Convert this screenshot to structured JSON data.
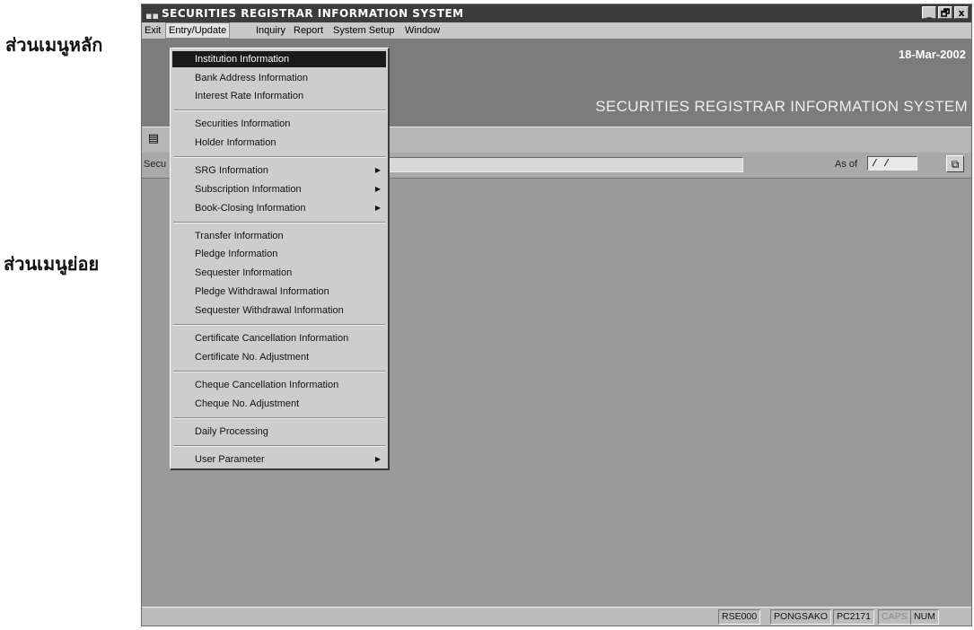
{
  "annotations": {
    "main_menu": "ส่วนเมนูหลัก",
    "sub_menu": "ส่วนเมนูย่อย"
  },
  "window": {
    "title": "SECURITIES REGISTRAR INFORMATION SYSTEM",
    "icon": "app-icon",
    "controls": [
      "_",
      "🗗",
      "x"
    ]
  },
  "menubar": {
    "items": [
      "Exit",
      "Entry/Update",
      "Inquiry",
      "Report",
      "System Setup",
      "Window"
    ]
  },
  "banner": {
    "date": "18-Mar-2002",
    "system_title": "SECURITIES REGISTRAR INFORMATION SYSTEM"
  },
  "filter": {
    "security_label": "Secu",
    "as_of_label": "As of",
    "date_value": "/ /"
  },
  "dropdown": {
    "items": [
      {
        "label": "Institution Information",
        "selected": true
      },
      {
        "label": "Bank Address Information"
      },
      {
        "label": "Interest Rate Information"
      },
      {
        "label": "Securities Information"
      },
      {
        "label": "Holder Information"
      },
      {
        "label": "SRG Information",
        "submenu": true
      },
      {
        "label": "Subscription Information",
        "submenu": true
      },
      {
        "label": "Book-Closing Information",
        "submenu": true
      },
      {
        "label": "Transfer Information"
      },
      {
        "label": "Pledge Information"
      },
      {
        "label": "Sequester Information"
      },
      {
        "label": "Pledge Withdrawal Information"
      },
      {
        "label": "Sequester Withdrawal Information"
      },
      {
        "label": "Certificate Cancellation Information"
      },
      {
        "label": "Certificate No. Adjustment"
      },
      {
        "label": "Cheque Cancellation Information"
      },
      {
        "label": "Cheque No. Adjustment"
      },
      {
        "label": "Daily Processing"
      },
      {
        "label": "User Parameter",
        "submenu": true
      }
    ]
  },
  "statusbar": {
    "cells": [
      "RSE000",
      "PONGSAKO",
      "PC2171",
      "CAPS",
      "NUM"
    ]
  }
}
